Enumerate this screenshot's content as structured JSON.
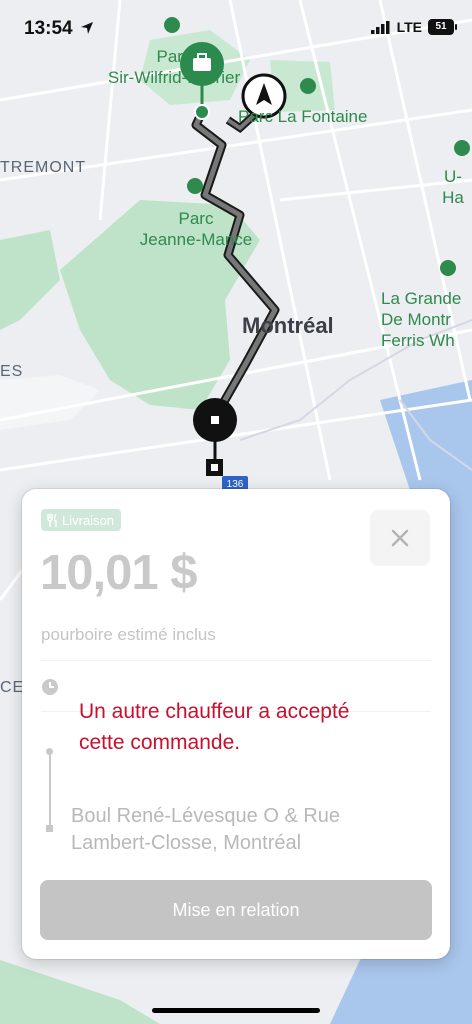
{
  "status_bar": {
    "time": "13:54",
    "network": "LTE",
    "battery": "51"
  },
  "map": {
    "labels": {
      "park_wilfrid": "Parc\nSir-Wilfrid-Laurier",
      "park_lafontaine": "Parc La Fontaine",
      "outremont": "TREMONT",
      "park_jeanne_mance": "Parc\nJeanne-Mance",
      "montreal": "Montréal",
      "grande": "La Grande\nDe Montr\nFerris Wh",
      "uha": "U-Ha",
      "es": "ES",
      "ce": "CE",
      "highway": "136"
    }
  },
  "card": {
    "badge": "Livraison",
    "price": "10,01 $",
    "tip_note": "pourboire estimé inclus",
    "alert": "Un autre chauffeur a accepté cette commande.",
    "dropoff": "Boul René-Lévesque O & Rue Lambert-Closse, Montréal",
    "contact_button": "Mise en relation"
  },
  "colors": {
    "alert": "#c8102e",
    "route": "#3a3a3a",
    "pickup_pin": "#2b8a4e",
    "park": "#bfe3c8",
    "water": "#a9c6ec"
  }
}
